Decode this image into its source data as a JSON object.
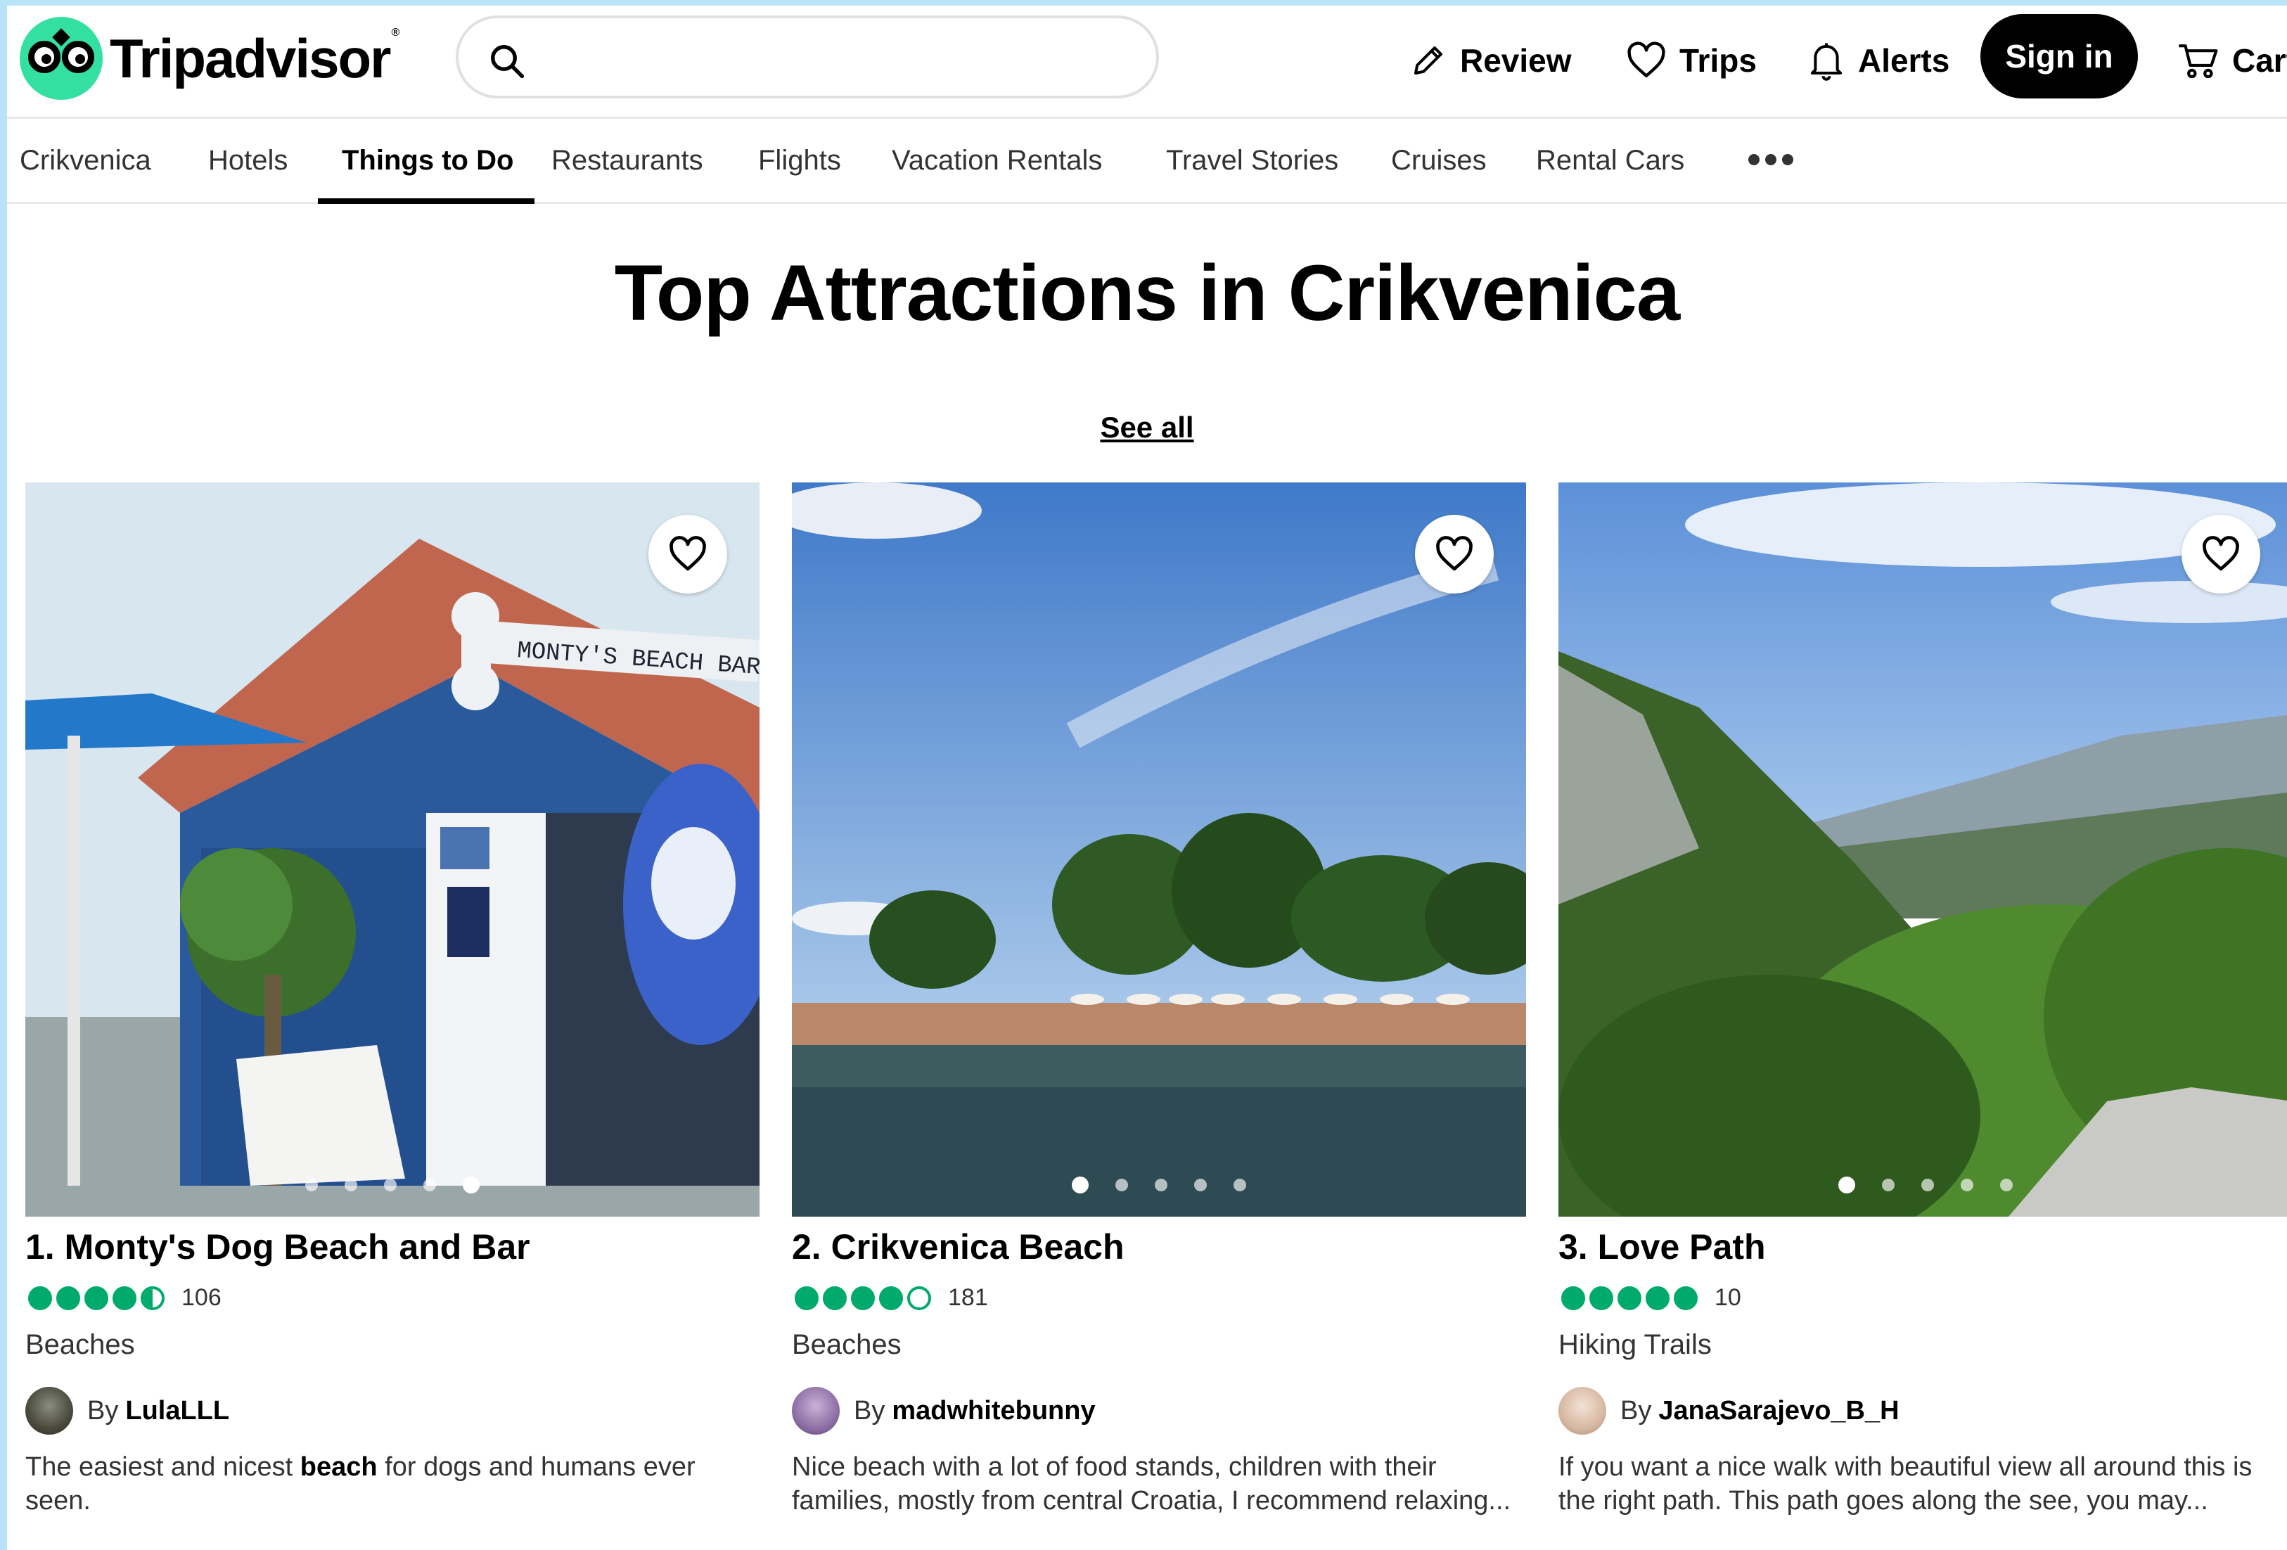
{
  "brand": {
    "name": "Tripadvisor",
    "mark": "®"
  },
  "search": {
    "placeholder": ""
  },
  "header": {
    "review": "Review",
    "trips": "Trips",
    "alerts": "Alerts",
    "signin": "Sign in",
    "cart": "Cart"
  },
  "tabs": [
    {
      "label": "Crikvenica"
    },
    {
      "label": "Hotels"
    },
    {
      "label": "Things to Do",
      "active": true
    },
    {
      "label": "Restaurants"
    },
    {
      "label": "Flights"
    },
    {
      "label": "Vacation Rentals"
    },
    {
      "label": "Travel Stories"
    },
    {
      "label": "Cruises"
    },
    {
      "label": "Rental Cars"
    }
  ],
  "page": {
    "title": "Top Attractions in Crikvenica",
    "see_all": "See all"
  },
  "cards": [
    {
      "title": "1. Monty's Dog Beach and Bar",
      "rating": 4.5,
      "reviews": "106",
      "category": "Beaches",
      "by": "By",
      "author": "LulaLLL",
      "snippet_before": "The easiest and nicest ",
      "snippet_bold": "beach",
      "snippet_after": " for dogs and humans ever seen.",
      "sign_text": "MONTY'S BEACH BAR",
      "carousel_active": 5
    },
    {
      "title": "2. Crikvenica Beach",
      "rating": 4,
      "reviews": "181",
      "category": "Beaches",
      "by": "By",
      "author": "madwhitebunny",
      "snippet_before": "Nice beach with a lot of food stands, children with their families, mostly from central Croatia, I recommend relaxing...",
      "snippet_bold": "",
      "snippet_after": "",
      "carousel_active": 1
    },
    {
      "title": "3. Love Path",
      "rating": 5,
      "reviews": "10",
      "category": "Hiking Trails",
      "by": "By",
      "author": "JanaSarajevo_B_H",
      "snippet_before": "If you want a nice walk with beautiful view all around this is the right path. This path goes along the see, you may...",
      "snippet_bold": "",
      "snippet_after": "",
      "carousel_active": 1
    }
  ],
  "colors": {
    "brand_green": "#34e0a1",
    "rating_green": "#00aa6c",
    "frame_blue": "#b9e3f6",
    "black": "#000000"
  }
}
